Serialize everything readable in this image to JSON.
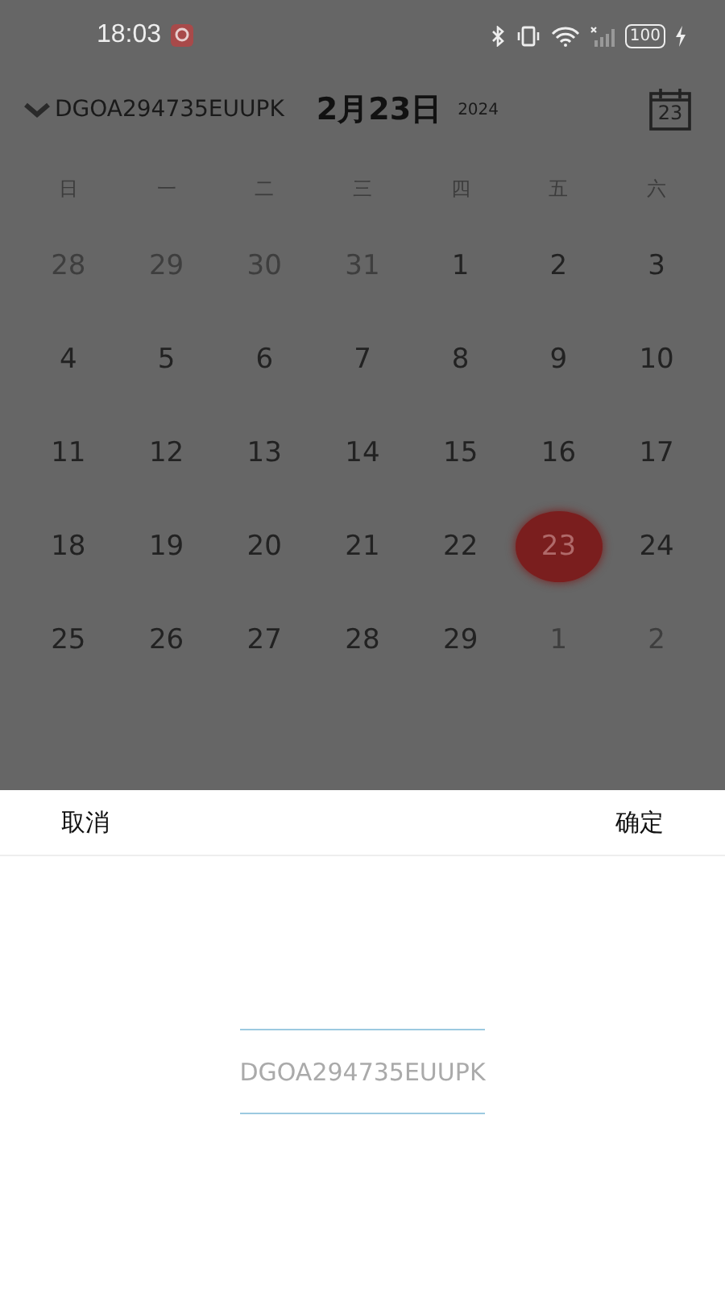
{
  "status_bar": {
    "time": "18:03",
    "battery": "100"
  },
  "header": {
    "device": "DGOA294735EUUPK",
    "date": "2月23日",
    "year": "2024",
    "calendar_icon_day": "23"
  },
  "weekdays": [
    "日",
    "一",
    "二",
    "三",
    "四",
    "五",
    "六"
  ],
  "days": [
    {
      "day": "28",
      "in_month": false,
      "selected": false
    },
    {
      "day": "29",
      "in_month": false,
      "selected": false
    },
    {
      "day": "30",
      "in_month": false,
      "selected": false
    },
    {
      "day": "31",
      "in_month": false,
      "selected": false
    },
    {
      "day": "1",
      "in_month": true,
      "selected": false
    },
    {
      "day": "2",
      "in_month": true,
      "selected": false
    },
    {
      "day": "3",
      "in_month": true,
      "selected": false
    },
    {
      "day": "4",
      "in_month": true,
      "selected": false
    },
    {
      "day": "5",
      "in_month": true,
      "selected": false
    },
    {
      "day": "6",
      "in_month": true,
      "selected": false
    },
    {
      "day": "7",
      "in_month": true,
      "selected": false
    },
    {
      "day": "8",
      "in_month": true,
      "selected": false
    },
    {
      "day": "9",
      "in_month": true,
      "selected": false
    },
    {
      "day": "10",
      "in_month": true,
      "selected": false
    },
    {
      "day": "11",
      "in_month": true,
      "selected": false
    },
    {
      "day": "12",
      "in_month": true,
      "selected": false
    },
    {
      "day": "13",
      "in_month": true,
      "selected": false
    },
    {
      "day": "14",
      "in_month": true,
      "selected": false
    },
    {
      "day": "15",
      "in_month": true,
      "selected": false
    },
    {
      "day": "16",
      "in_month": true,
      "selected": false
    },
    {
      "day": "17",
      "in_month": true,
      "selected": false
    },
    {
      "day": "18",
      "in_month": true,
      "selected": false
    },
    {
      "day": "19",
      "in_month": true,
      "selected": false
    },
    {
      "day": "20",
      "in_month": true,
      "selected": false
    },
    {
      "day": "21",
      "in_month": true,
      "selected": false
    },
    {
      "day": "22",
      "in_month": true,
      "selected": false
    },
    {
      "day": "23",
      "in_month": true,
      "selected": true
    },
    {
      "day": "24",
      "in_month": true,
      "selected": false
    },
    {
      "day": "25",
      "in_month": true,
      "selected": false
    },
    {
      "day": "26",
      "in_month": true,
      "selected": false
    },
    {
      "day": "27",
      "in_month": true,
      "selected": false
    },
    {
      "day": "28",
      "in_month": true,
      "selected": false
    },
    {
      "day": "29",
      "in_month": true,
      "selected": false
    },
    {
      "day": "1",
      "in_month": false,
      "selected": false
    },
    {
      "day": "2",
      "in_month": false,
      "selected": false
    }
  ],
  "sheet": {
    "cancel": "取消",
    "confirm": "确定",
    "options": [
      {
        "label": "DGOA294735EUUPK",
        "selected": true
      }
    ]
  }
}
